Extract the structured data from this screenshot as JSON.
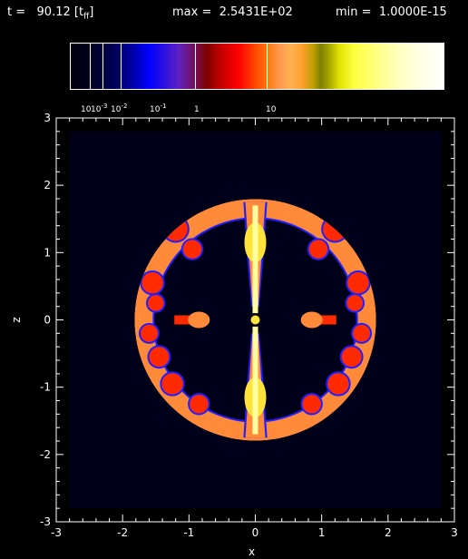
{
  "header": {
    "time_label": "t =",
    "time_value": "90.12",
    "time_unit_base": "[t",
    "time_unit_sub": "ff",
    "time_unit_close": "]",
    "max_label": "max =",
    "max_value": "2.5431E+02",
    "min_label": "min =",
    "min_value": "1.0000E-15"
  },
  "colorbar": {
    "labels": [
      {
        "base": "10",
        "exp": ""
      },
      {
        "base": "10",
        "exp": "-3"
      },
      {
        "base": "10",
        "exp": "-2"
      },
      {
        "base": "10",
        "exp": "-1"
      },
      {
        "base": "1",
        "exp": ""
      },
      {
        "base": "10",
        "exp": ""
      }
    ]
  },
  "plot": {
    "xlabel": "x",
    "ylabel": "z",
    "xlim": [
      -3,
      3
    ],
    "ylim": [
      -3,
      3
    ],
    "x_ticks": [
      "-3",
      "-2",
      "-1",
      "0",
      "1",
      "2",
      "3"
    ],
    "y_ticks": [
      "-3",
      "-2",
      "-1",
      "0",
      "1",
      "2",
      "3"
    ],
    "sphere_radius": 1.82,
    "domain_extent": 2.8,
    "colors": {
      "background": "#000000",
      "domain": "#00001a",
      "axes": "#ffffff",
      "shell_outer": "#ff8a3a",
      "shell_inner": "#ff2a00",
      "jet": "#ffe33a",
      "jet_core": "#ffffa0",
      "edge": "#2020ff"
    }
  }
}
